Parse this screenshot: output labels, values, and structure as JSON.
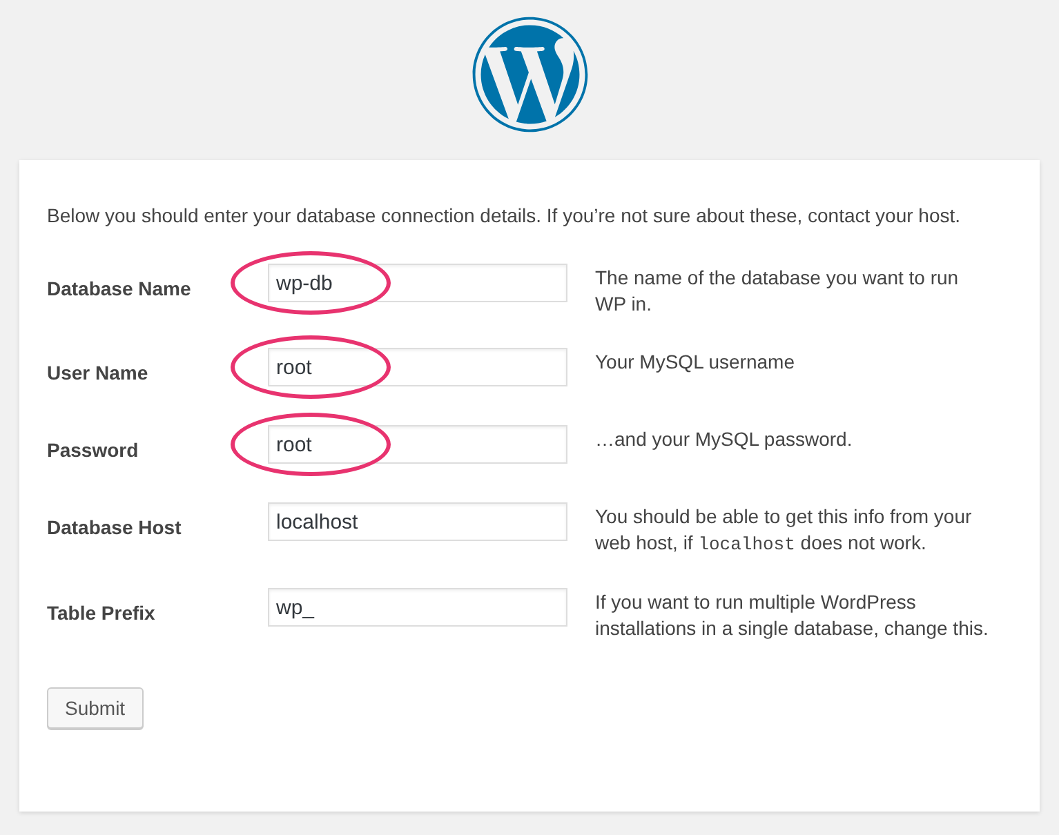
{
  "intro": "Below you should enter your database connection details. If you’re not sure about these, contact your host.",
  "fields": [
    {
      "label": "Database Name",
      "value": "wp-db",
      "highlighted": true,
      "description": [
        {
          "kind": "text",
          "text": "The name of the database you want to run WP in."
        }
      ]
    },
    {
      "label": "User Name",
      "value": "root",
      "highlighted": true,
      "description": [
        {
          "kind": "text",
          "text": "Your MySQL username"
        }
      ]
    },
    {
      "label": "Password",
      "value": "root",
      "highlighted": true,
      "description": [
        {
          "kind": "text",
          "text": "…and your MySQL password."
        }
      ]
    },
    {
      "label": "Database Host",
      "value": "localhost",
      "highlighted": false,
      "description": [
        {
          "kind": "text",
          "text": "You should be able to get this info from your web host, if "
        },
        {
          "kind": "code",
          "text": "localhost"
        },
        {
          "kind": "text",
          "text": " does not work."
        }
      ]
    },
    {
      "label": "Table Prefix",
      "value": "wp_",
      "highlighted": false,
      "description": [
        {
          "kind": "text",
          "text": "If you want to run multiple WordPress installations in a single database, change this."
        }
      ]
    }
  ],
  "submit": "Submit"
}
